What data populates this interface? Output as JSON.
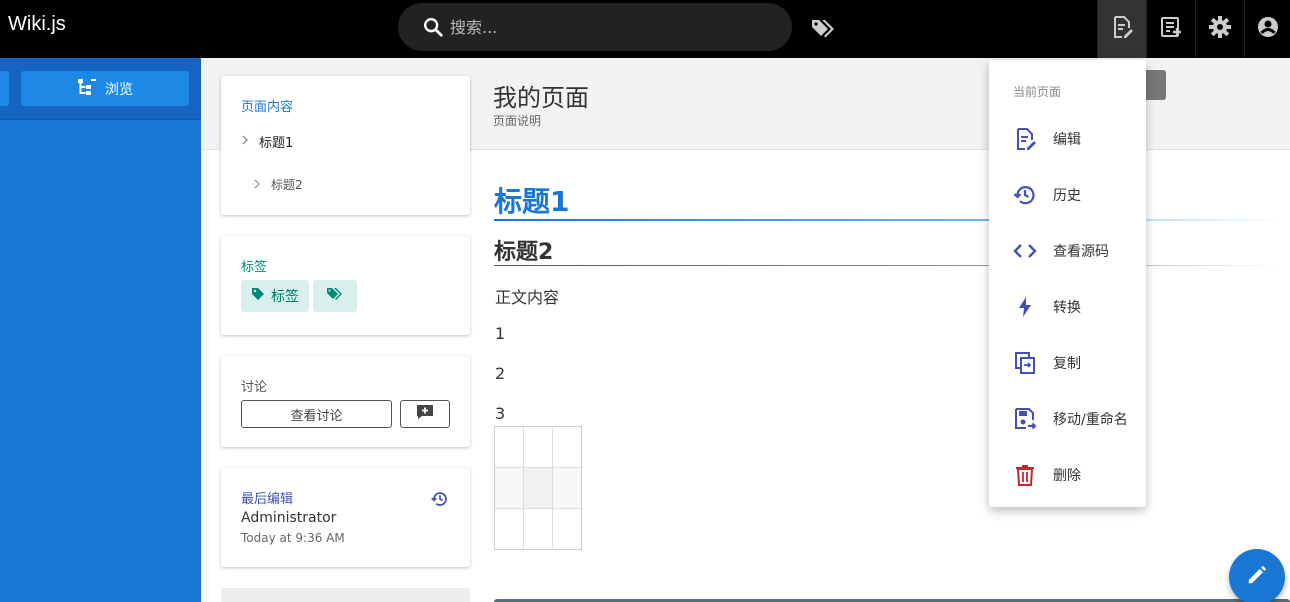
{
  "app": {
    "brand": "Wiki.js"
  },
  "search": {
    "placeholder": "搜索..."
  },
  "nav": {
    "browse_label": "浏览"
  },
  "page": {
    "title": "我的页面",
    "description": "页面说明"
  },
  "toc": {
    "title": "页面内容",
    "items": [
      {
        "label": "标题1"
      },
      {
        "label": "标题2"
      }
    ]
  },
  "tags": {
    "title": "标签",
    "chip_label": "标签"
  },
  "discussion": {
    "title": "讨论",
    "view_button": "查看讨论"
  },
  "last_edit": {
    "title": "最后编辑",
    "author": "Administrator",
    "time": "Today at 9:36 AM"
  },
  "content": {
    "h1": "标题1",
    "h2": "标题2",
    "paragraphs": [
      "正文内容",
      "1",
      "2",
      "3"
    ]
  },
  "menu": {
    "header": "当前页面",
    "items": [
      {
        "label": "编辑",
        "icon": "edit-page-icon"
      },
      {
        "label": "历史",
        "icon": "history-icon"
      },
      {
        "label": "查看源码",
        "icon": "code-icon"
      },
      {
        "label": "转换",
        "icon": "bolt-icon"
      },
      {
        "label": "复制",
        "icon": "duplicate-icon"
      },
      {
        "label": "移动/重命名",
        "icon": "move-icon"
      },
      {
        "label": "删除",
        "icon": "delete-icon"
      }
    ]
  },
  "colors": {
    "primary": "#1976d2",
    "tag": "#00897b",
    "danger": "#c62828",
    "menu_icon": "#3f51b5"
  }
}
